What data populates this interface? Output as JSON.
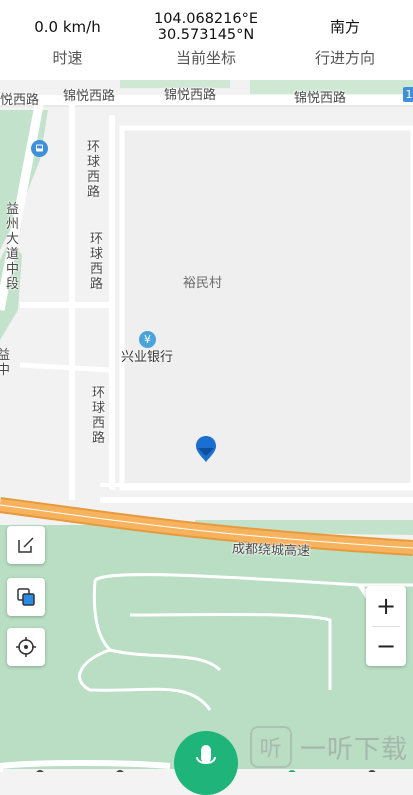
{
  "info_bar": {
    "speed": {
      "value": "0.0 km/h",
      "label": "时速"
    },
    "coordinate": {
      "lon": "104.068216°E",
      "lat": "30.573145°N",
      "label": "当前坐标"
    },
    "direction": {
      "value": "南方",
      "label": "行进方向"
    }
  },
  "map": {
    "roads": {
      "jinyue_1": "锦悦西路",
      "jinyue_2": "锦悦西路",
      "jinyue_3": "锦悦西路",
      "jinyue_left": "悦西路",
      "huanqiu_1": "环球西路",
      "huanqiu_2": "环球西路",
      "huanqiu_3": "环球西路",
      "yizhou": "益州大道中段",
      "expressway": "成都绕城高速",
      "left_edge": "益",
      "left_edge_2": "中",
      "badge": "1"
    },
    "pois": {
      "village": "裕民村",
      "bank": "兴业银行",
      "bank_icon": "yen-icon",
      "bus_icon": "bus-stop-icon"
    },
    "marker_icon": "location-pin-icon",
    "colors": {
      "green": "#b9dec3",
      "road": "#ffffff",
      "expressway": "#f4a64a",
      "marker": "#1a6fd0"
    }
  },
  "tools": {
    "edit_icon": "edit-icon",
    "layers_icon": "layers-icon",
    "locate_icon": "locate-icon"
  },
  "zoom": {
    "in": "+",
    "out": "−"
  },
  "bottom": {
    "mic_icon": "microphone-icon"
  },
  "watermark": {
    "text": "一听下载",
    "logo": "听"
  }
}
